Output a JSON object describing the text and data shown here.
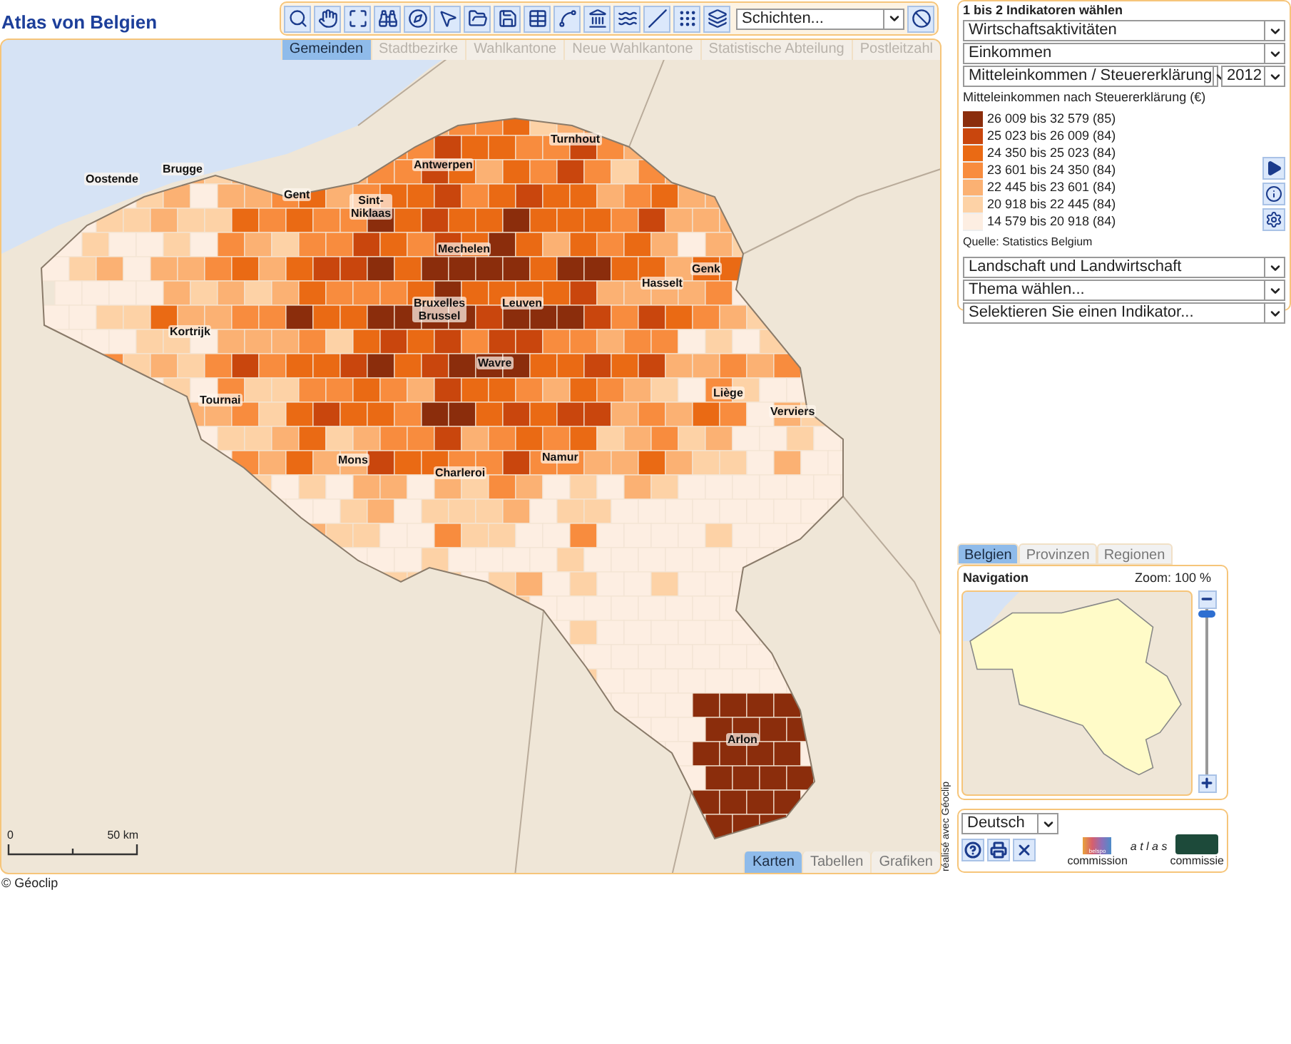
{
  "title": "Atlas von Belgien",
  "toolbar": {
    "layers_select": "Schichten..."
  },
  "map_tabs": [
    {
      "label": "Gemeinden",
      "selected": true
    },
    {
      "label": "Stadtbezirke",
      "selected": false
    },
    {
      "label": "Wahlkantone",
      "selected": false
    },
    {
      "label": "Neue Wahlkantone",
      "selected": false
    },
    {
      "label": "Statistische Abteilung",
      "selected": false
    },
    {
      "label": "Postleitzahl",
      "selected": false
    }
  ],
  "map": {
    "cities": [
      "Oostende",
      "Brugge",
      "Antwerpen",
      "Turnhout",
      "Sint-Niklaas",
      "Gent",
      "Mechelen",
      "Genk",
      "Hasselt",
      "Bruxelles Brussel",
      "Leuven",
      "Kortrijk",
      "Wavre",
      "Tournai",
      "Liège",
      "Verviers",
      "Mons",
      "Charleroi",
      "Namur",
      "Arlon"
    ],
    "scale": {
      "start": "0",
      "end": "50 km"
    }
  },
  "view_tabs": [
    {
      "label": "Karten",
      "selected": true
    },
    {
      "label": "Tabellen",
      "selected": false
    },
    {
      "label": "Grafiken",
      "selected": false
    }
  ],
  "credit": "© Géoclip",
  "side_credit": "réalisé avec Géoclip",
  "indicators": {
    "heading": "1 bis 2 Indikatoren wählen",
    "selects": [
      "Wirtschaftsaktivitäten",
      "Einkommen"
    ],
    "indicator": "Mitteleinkommen / Steuererklärung",
    "year": "2012",
    "legend_title": "Mitteleinkommen nach Steuererklärung (€)",
    "legend": [
      {
        "label": "26 009 bis 32 579 (85)",
        "color": "#8b2d0c"
      },
      {
        "label": "25 023 bis 26 009 (84)",
        "color": "#c9460d"
      },
      {
        "label": "24 350 bis 25 023 (84)",
        "color": "#ea6a14"
      },
      {
        "label": "23 601 bis 24 350 (84)",
        "color": "#f88c3e"
      },
      {
        "label": "22 445 bis 23 601 (84)",
        "color": "#fbb173"
      },
      {
        "label": "20 918 bis 22 445 (84)",
        "color": "#fdd2a6"
      },
      {
        "label": "14 579 bis 20 918 (84)",
        "color": "#fdeee2"
      }
    ],
    "source": "Quelle: Statistics Belgium",
    "lower_selects": [
      "Landschaft und Landwirtschaft",
      "Thema wählen...",
      "Selektieren Sie einen Indikator..."
    ]
  },
  "navigation": {
    "tabs": [
      {
        "label": "Belgien",
        "selected": true
      },
      {
        "label": "Provinzen",
        "selected": false
      },
      {
        "label": "Regionen",
        "selected": false
      }
    ],
    "title": "Navigation",
    "zoom": "Zoom: 100 %",
    "level": 0
  },
  "footer": {
    "language": "Deutsch",
    "logos": [
      "belspo",
      "commission",
      "a t l a s",
      "commissie"
    ]
  }
}
